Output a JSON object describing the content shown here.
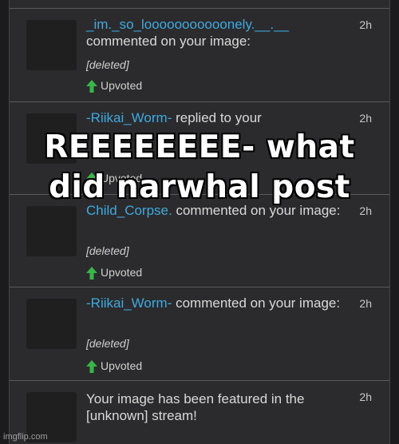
{
  "notifications": [
    {
      "user": "_im._so_looooooooooonely.__.__",
      "action": " commented on your image:",
      "time": "2h",
      "detail": "[deleted]",
      "vote": "Upvoted"
    },
    {
      "user": "-Riikai_Worm-",
      "action": " replied to your",
      "time": "2h",
      "detail": "",
      "vote": "Upvoted"
    },
    {
      "user": "Child_Corpse.",
      "action": " commented on your image:",
      "time": "2h",
      "detail": "[deleted]",
      "vote": "Upvoted"
    },
    {
      "user": "-Riikai_Worm-",
      "action": " commented on your image:",
      "time": "2h",
      "detail": "[deleted]",
      "vote": "Upvoted"
    },
    {
      "user": "",
      "action": "Your image has been featured in the [unknown] stream!",
      "time": "2h",
      "detail": "",
      "vote": ""
    }
  ],
  "overlay": {
    "line1": "REEEEEEEE- what",
    "line2": "did narwhal post"
  },
  "watermark": "imgflip.com",
  "colors": {
    "username": "#3fa9e0",
    "upvote_arrow": "#39b54a",
    "background": "#2b2b2d"
  }
}
